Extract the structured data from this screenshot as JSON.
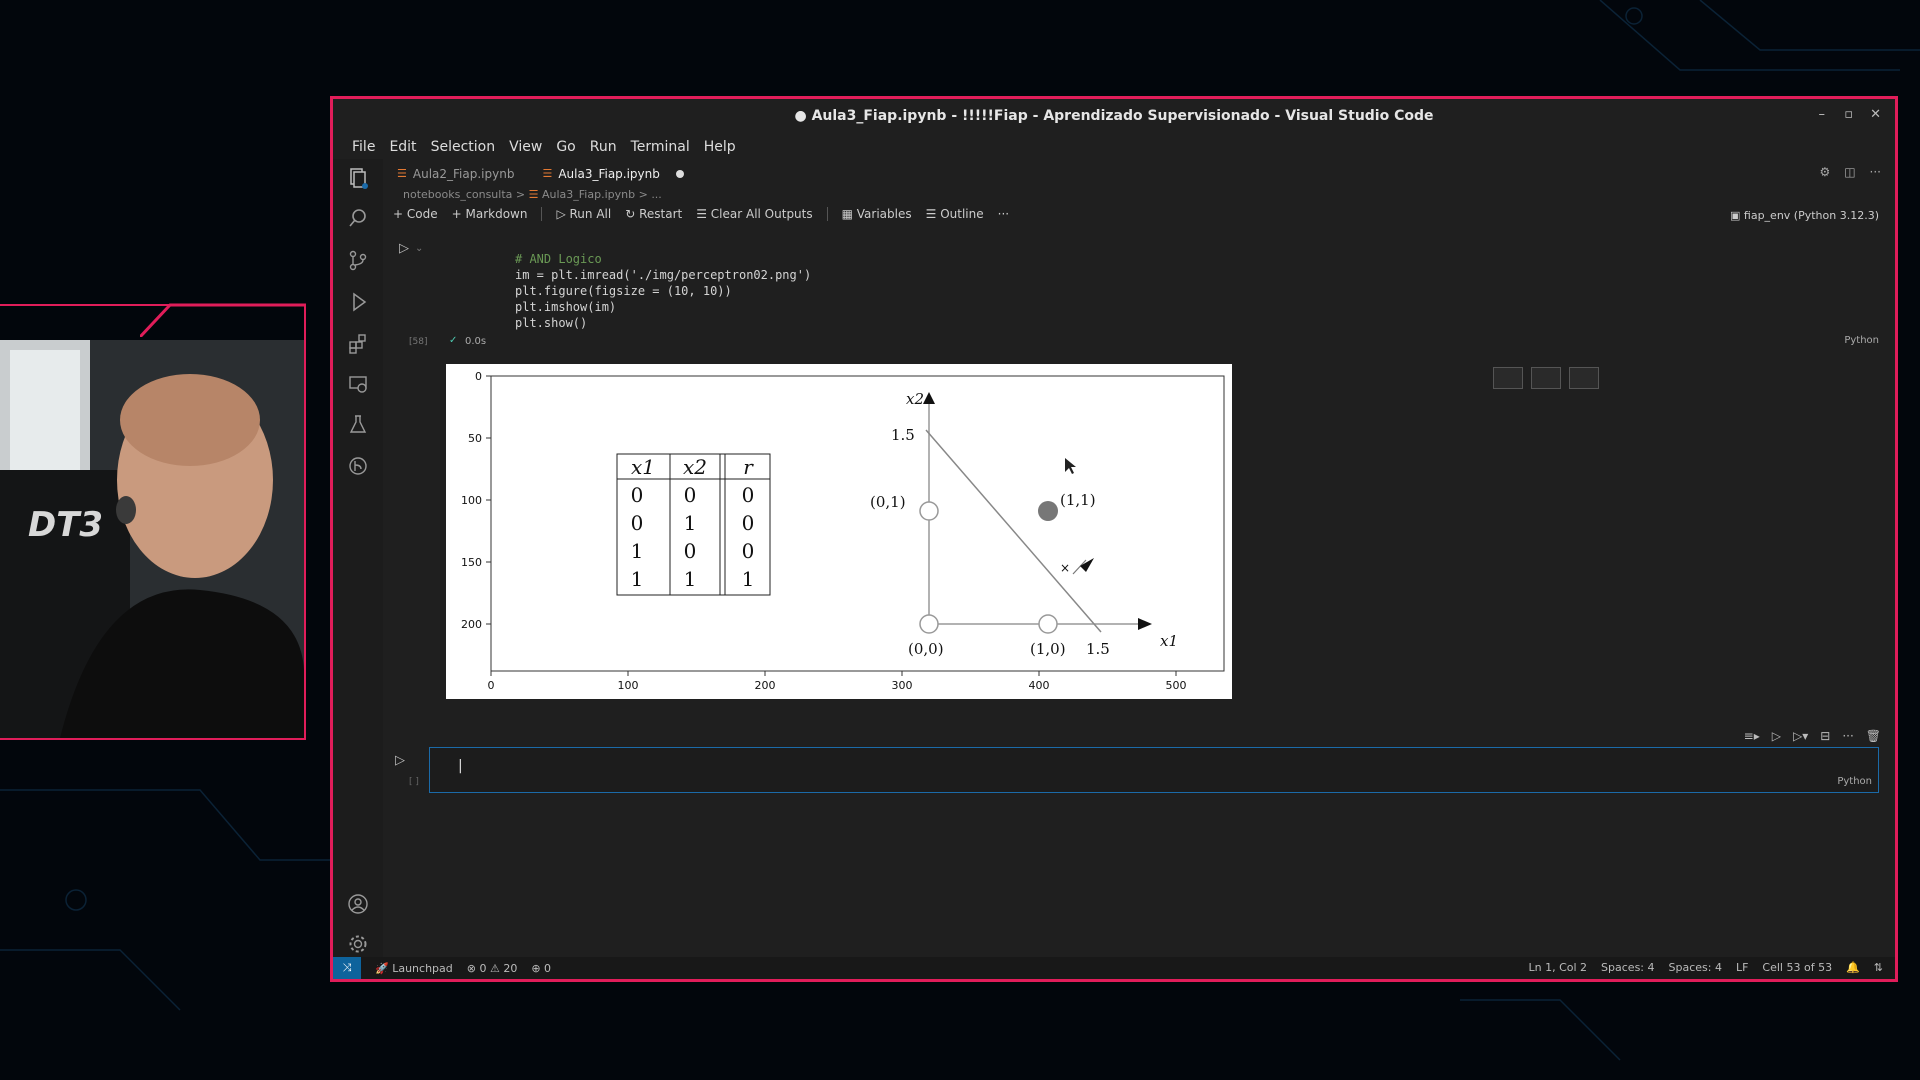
{
  "window": {
    "title": "● Aula3_Fiap.ipynb - !!!!!Fiap - Aprendizado Supervisionado - Visual Studio Code"
  },
  "menu": [
    "File",
    "Edit",
    "Selection",
    "View",
    "Go",
    "Run",
    "Terminal",
    "Help"
  ],
  "tabs": [
    {
      "label": "Aula2_Fiap.ipynb",
      "active": false
    },
    {
      "label": "Aula3_Fiap.ipynb",
      "active": true
    }
  ],
  "breadcrumb": {
    "folder": "notebooks_consulta",
    "file": "Aula3_Fiap.ipynb",
    "trail": "..."
  },
  "toolbar": {
    "code": "Code",
    "markdown": "Markdown",
    "run_all": "Run All",
    "restart": "Restart",
    "clear_outputs": "Clear All Outputs",
    "variables": "Variables",
    "outline": "Outline",
    "more": "···"
  },
  "kernel": "fiap_env (Python 3.12.3)",
  "cell1": {
    "exec_count": "[58]",
    "status": "0.0s",
    "language": "Python",
    "lines": [
      "# AND Logico",
      "im = plt.imread('./img/perceptron02.png')",
      "plt.figure(figsize = (10, 10))",
      "plt.imshow(im)",
      "plt.show()"
    ]
  },
  "figure": {
    "y_ticks": [
      "0",
      "50",
      "100",
      "150",
      "200"
    ],
    "x_ticks": [
      "0",
      "100",
      "200",
      "300",
      "400",
      "500"
    ],
    "table_headers": [
      "x1",
      "x2",
      "r"
    ],
    "table_rows": [
      [
        "0",
        "0",
        "0"
      ],
      [
        "0",
        "1",
        "0"
      ],
      [
        "1",
        "0",
        "0"
      ],
      [
        "1",
        "1",
        "1"
      ]
    ],
    "plot_labels": {
      "x2": "x2",
      "x1": "x1",
      "p01": "(0,1)",
      "p11": "(1,1)",
      "p00": "(0,0)",
      "p10": "(1,0)",
      "tick_y": "1.5",
      "tick_x": "1.5"
    }
  },
  "cell2": {
    "exec_count": "[ ]",
    "language": "Python"
  },
  "statusbar": {
    "launchpad": "Launchpad",
    "errors": "0",
    "warnings": "20",
    "ports": "0",
    "position": "Ln 1, Col 2",
    "spaces1": "Spaces: 4",
    "spaces2": "Spaces: 4",
    "eol": "LF",
    "cell": "Cell 53 of 53"
  },
  "colors": {
    "accent": "#e01d5a",
    "editor_bg": "#1f1f1f",
    "focus": "#1b6aa8"
  }
}
